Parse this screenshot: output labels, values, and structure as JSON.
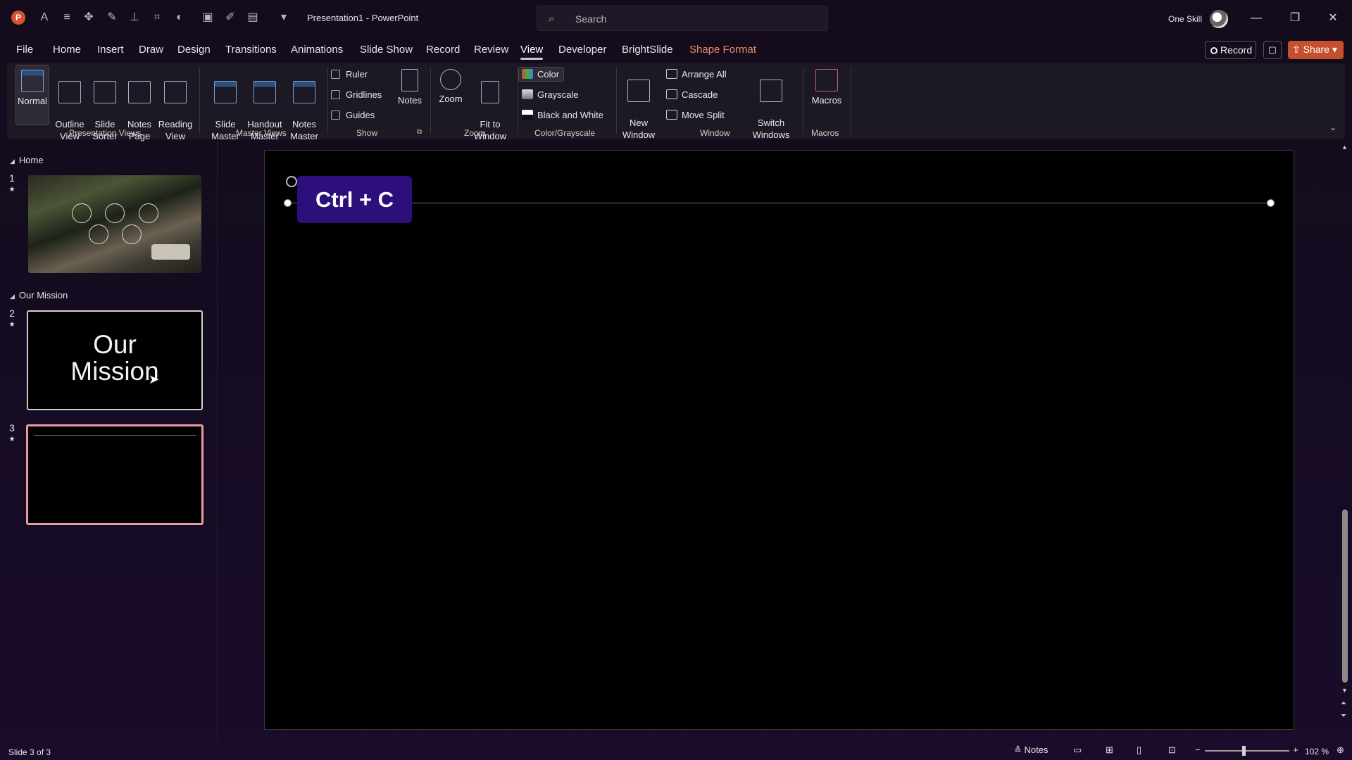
{
  "titlebar": {
    "doc_title": "Presentation1  -  PowerPoint",
    "search_placeholder": "Search",
    "user_name": "One Skill",
    "app_letter": "P"
  },
  "tabs": [
    "File",
    "Home",
    "Insert",
    "Draw",
    "Design",
    "Transitions",
    "Animations",
    "Slide Show",
    "Record",
    "Review",
    "View",
    "Developer",
    "BrightSlide",
    "Shape Format"
  ],
  "active_tab": "View",
  "right_actions": {
    "record": "Record",
    "share": "Share"
  },
  "ribbon": {
    "presentation_views": {
      "label": "Presentation Views",
      "buttons": [
        "Normal",
        "Outline\nView",
        "Slide\nSorter",
        "Notes\nPage",
        "Reading\nView"
      ]
    },
    "master_views": {
      "label": "Master Views",
      "buttons": [
        "Slide\nMaster",
        "Handout\nMaster",
        "Notes\nMaster"
      ]
    },
    "show": {
      "label": "Show",
      "checks": [
        "Ruler",
        "Gridlines",
        "Guides"
      ],
      "notes": "Notes"
    },
    "zoom": {
      "label": "Zoom",
      "buttons": [
        "Zoom",
        "Fit to\nWindow"
      ]
    },
    "color": {
      "label": "Color/Grayscale",
      "items": [
        "Color",
        "Grayscale",
        "Black and White"
      ]
    },
    "window": {
      "label": "Window",
      "new_window": "New\nWindow",
      "items": [
        "Arrange All",
        "Cascade",
        "Move Split"
      ],
      "switch": "Switch\nWindows"
    },
    "macros": {
      "label": "Macros",
      "button": "Macros"
    }
  },
  "slides_panel": {
    "sections": [
      "Home",
      "Our Mission"
    ],
    "slide_numbers": [
      "1",
      "2",
      "3"
    ],
    "slide2_text": "Our\nMission"
  },
  "canvas": {
    "title_placeholder": "O",
    "shortcut": "Ctrl + C"
  },
  "status": {
    "slide_info": "Slide 3 of 3",
    "notes": "Notes",
    "zoom": "102 %"
  },
  "colors": {
    "accent": "#c4502d",
    "badge": "#2c0f7a",
    "selected_thumb": "#e89a9e"
  }
}
